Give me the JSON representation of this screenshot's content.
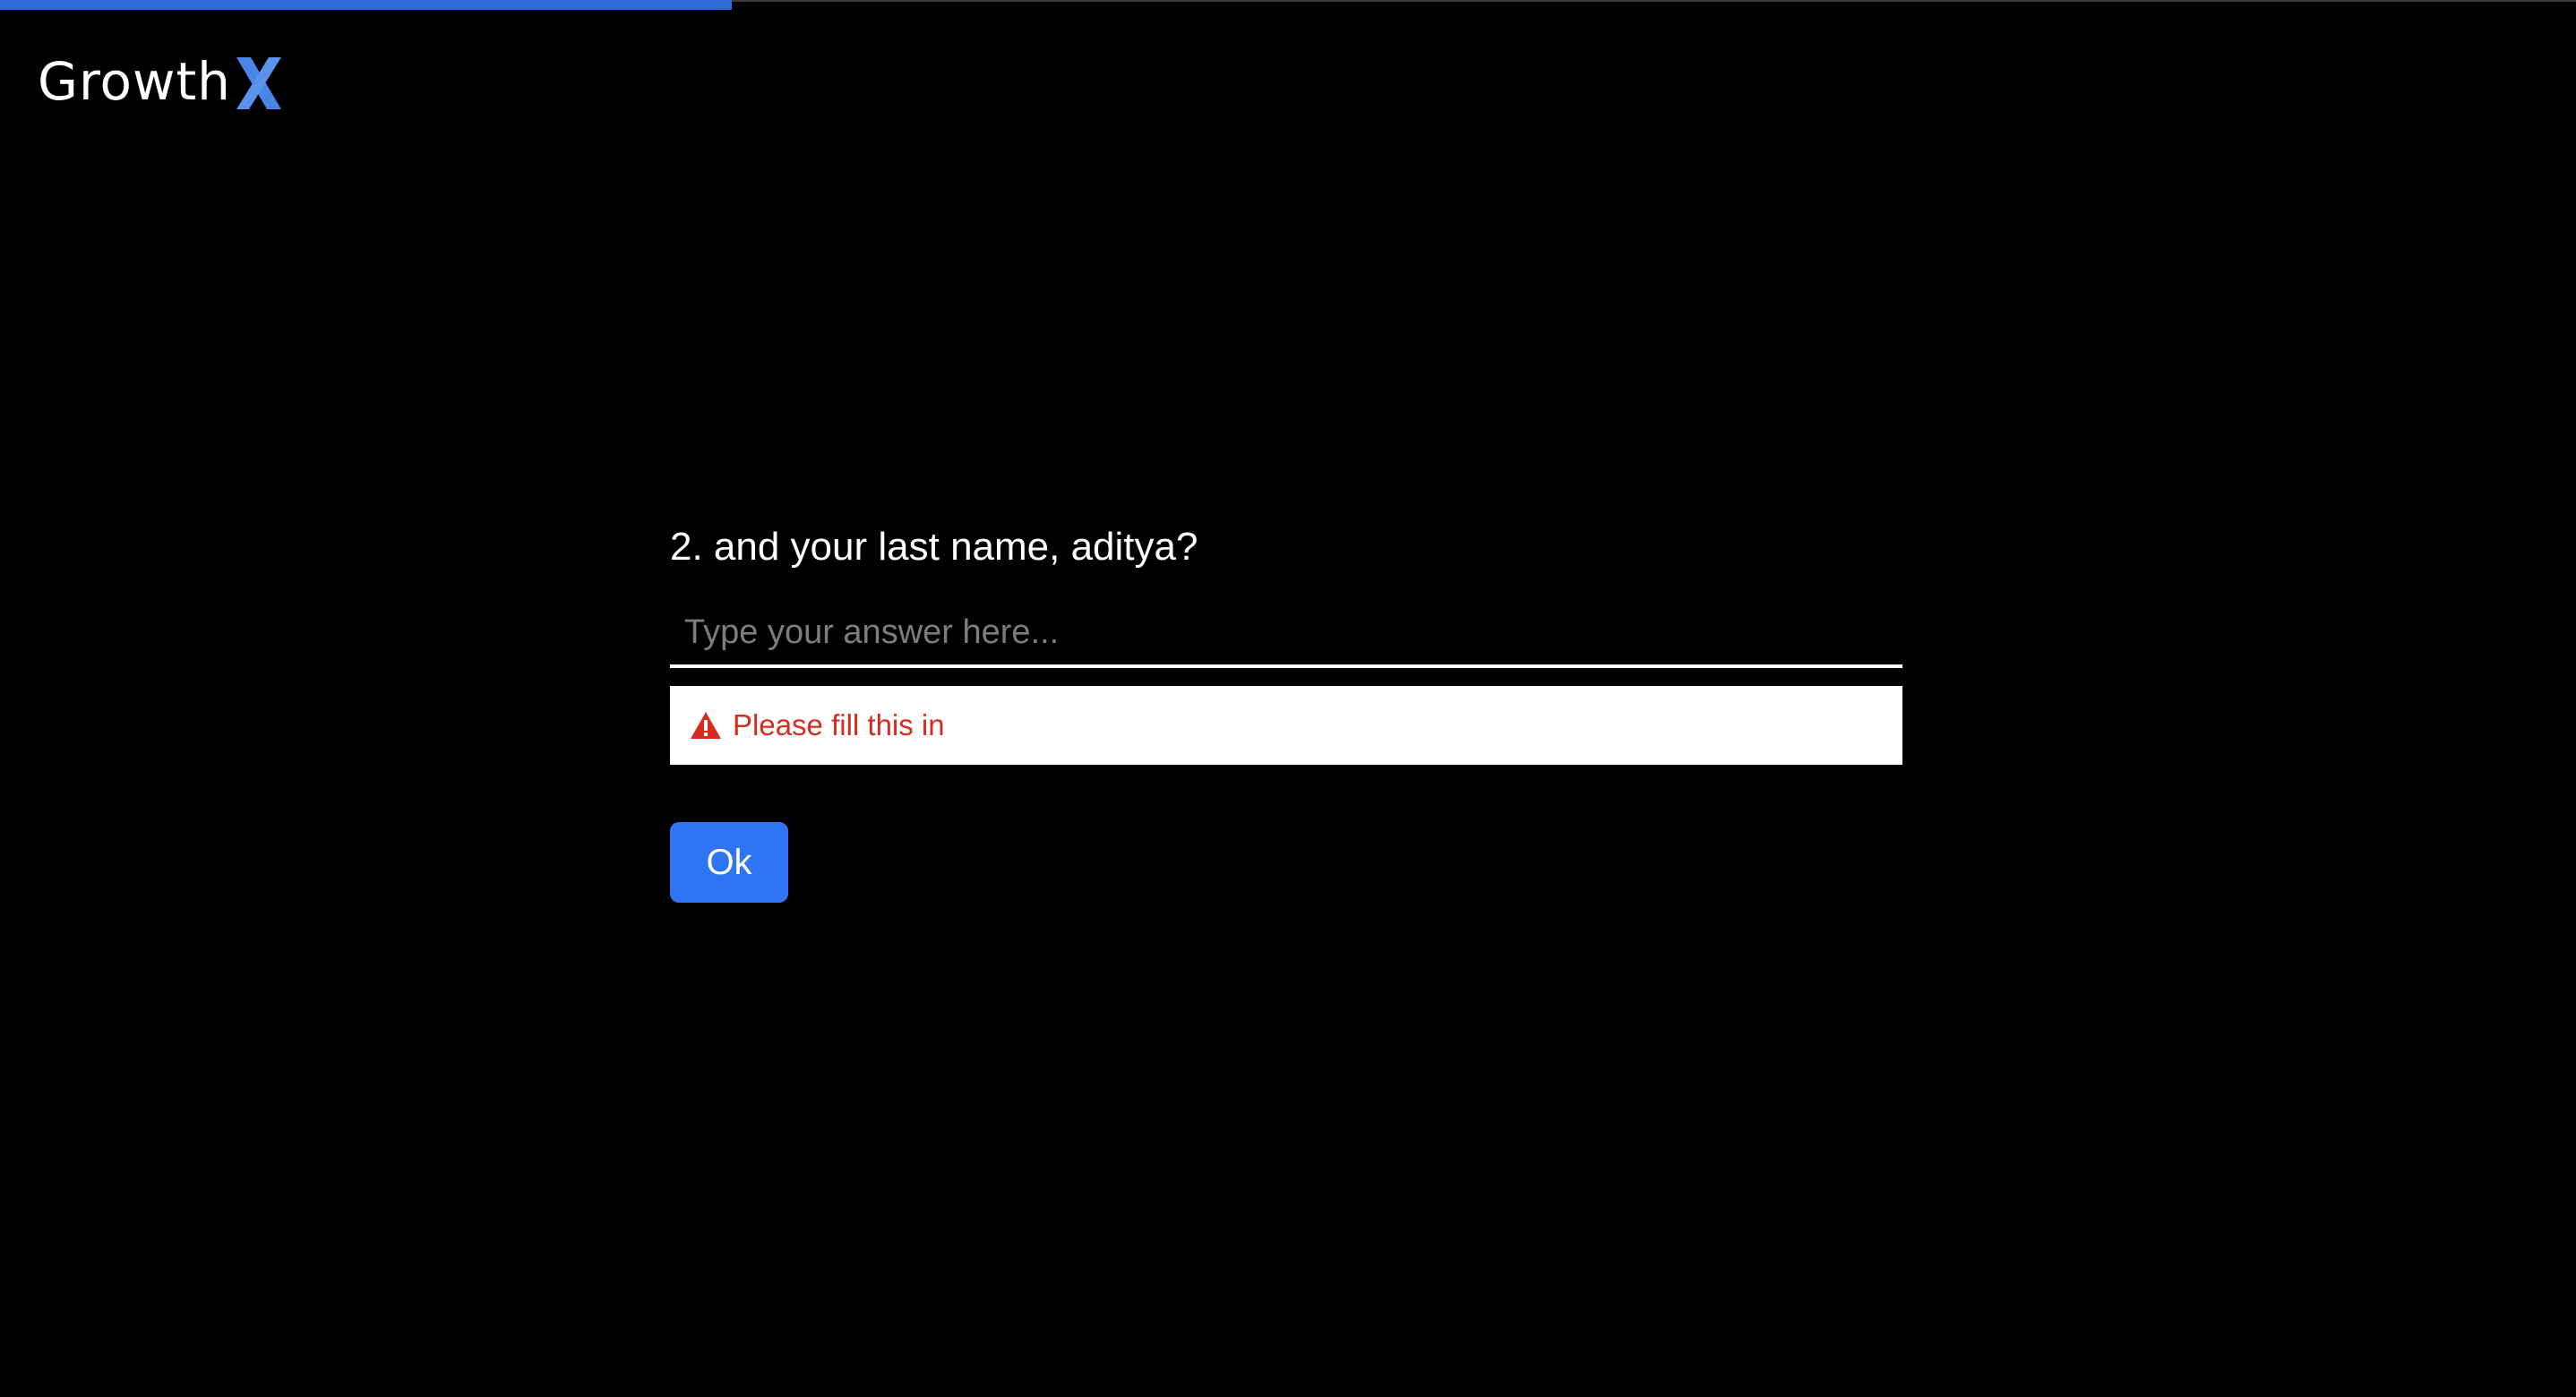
{
  "progress": {
    "fraction": 0.284,
    "color": "#2e6ad9"
  },
  "brand": {
    "name": "Growth",
    "accent_letter": "X",
    "accent_color": "#4a86e8"
  },
  "question": {
    "text": "2. and your last name, aditya?"
  },
  "answer": {
    "value": "",
    "placeholder": "Type your answer here..."
  },
  "error": {
    "icon": "warning-icon",
    "message": "Please fill this in",
    "color": "#d62d20"
  },
  "actions": {
    "ok_label": "Ok",
    "ok_color": "#2f74f5"
  }
}
